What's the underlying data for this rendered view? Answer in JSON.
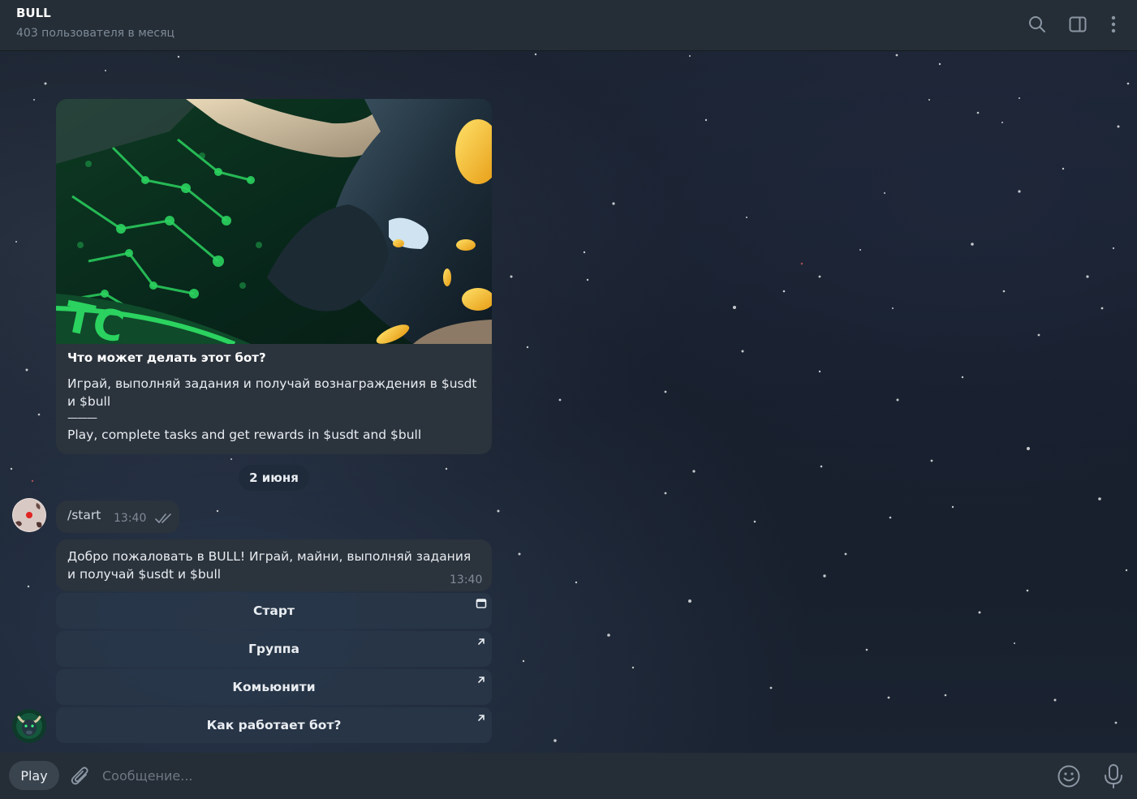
{
  "header": {
    "title": "BULL",
    "subtitle": "403 пользователя в месяц",
    "icons": [
      "search-icon",
      "sidebar-toggle-icon",
      "more-vertical-icon"
    ]
  },
  "bot_info": {
    "title": "Что может делать этот бот?",
    "description_ru": "Играй, выполняй задания и получай вознаграждения в $usdt и $bull",
    "separator": "———",
    "description_en": "Play, complete tasks and get rewards in $usdt and $bull"
  },
  "date_divider": "2 июня",
  "messages": [
    {
      "text": "/start",
      "time": "13:40",
      "status": "read"
    },
    {
      "text": "Добро пожаловать в BULL! Играй, майни, выполняй задания и получай $usdt и $bull",
      "time": "13:40"
    }
  ],
  "keyboard": [
    {
      "label": "Старт",
      "icon": "web-app-icon"
    },
    {
      "label": "Группа",
      "icon": "external-link-icon"
    },
    {
      "label": "Комьюнити",
      "icon": "external-link-icon"
    },
    {
      "label": "Как работает бот?",
      "icon": "external-link-icon"
    }
  ],
  "composer": {
    "menu_button": "Play",
    "placeholder": "Сообщение..."
  },
  "colors": {
    "header_bg": "#252d36",
    "bubble_bg": "#2b333d",
    "keyboard_bg": "#283648",
    "muted_text": "#7d8b99"
  }
}
